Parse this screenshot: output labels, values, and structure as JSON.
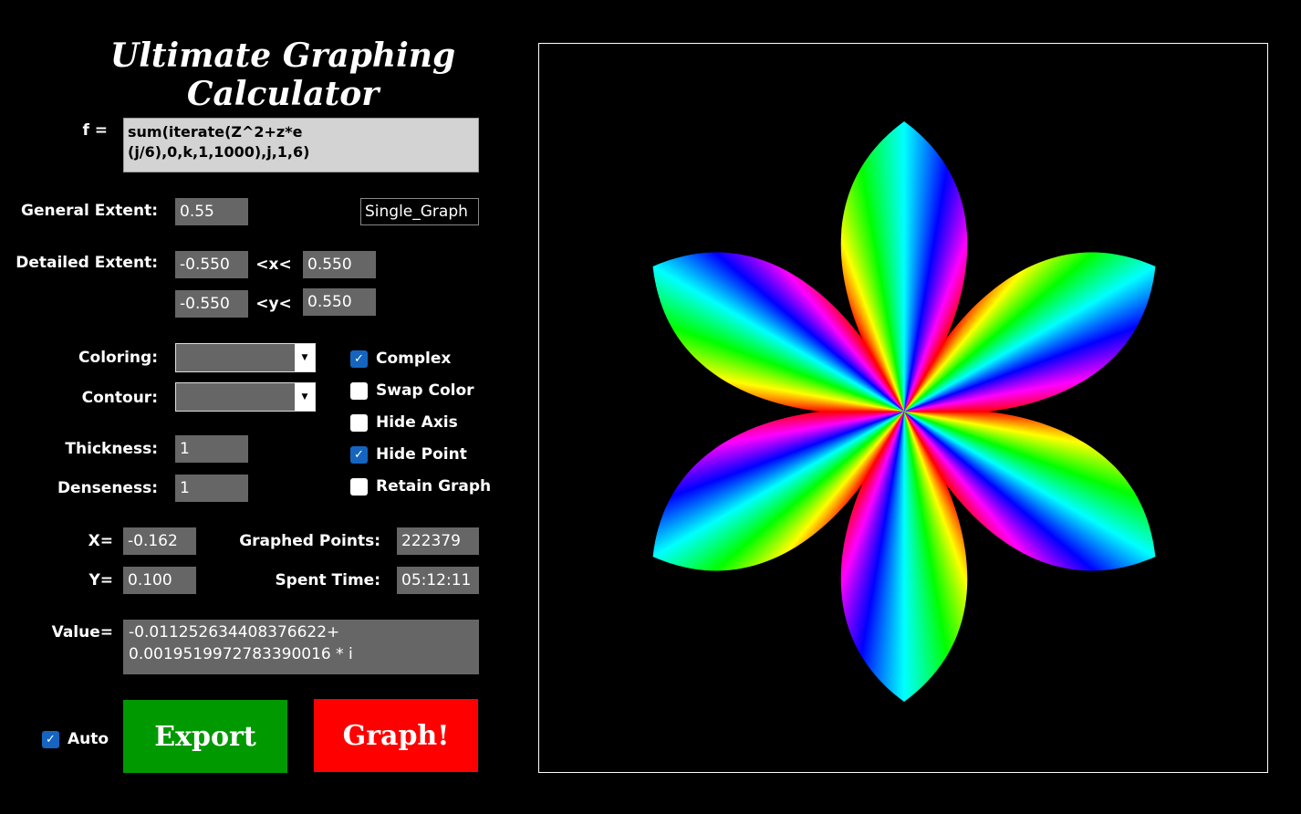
{
  "title": "Ultimate Graphing Calculator",
  "formula": {
    "label": "f =",
    "value": "sum(iterate(Z^2+z*e (j/6),0,k,1,1000),j,1,6)"
  },
  "general_extent": {
    "label": "General Extent:",
    "value": "0.55"
  },
  "mode": "Single_Graph",
  "detailed_extent": {
    "label": "Detailed Extent:",
    "x_min": "-0.550",
    "x_sep": "<x<",
    "x_max": "0.550",
    "y_min": "-0.550",
    "y_sep": "<y<",
    "y_max": "0.550"
  },
  "coloring": {
    "label": "Coloring:",
    "value": ""
  },
  "contour": {
    "label": "Contour:",
    "value": ""
  },
  "thickness": {
    "label": "Thickness:",
    "value": "1"
  },
  "denseness": {
    "label": "Denseness:",
    "value": "1"
  },
  "options": [
    {
      "label": "Complex",
      "checked": true
    },
    {
      "label": "Swap Color",
      "checked": false
    },
    {
      "label": "Hide Axis",
      "checked": false
    },
    {
      "label": "Hide Point",
      "checked": true
    },
    {
      "label": "Retain Graph",
      "checked": false
    }
  ],
  "x": {
    "label": "X=",
    "value": "-0.162"
  },
  "y": {
    "label": "Y=",
    "value": "0.100"
  },
  "graphed_points": {
    "label": "Graphed Points:",
    "value": "222379"
  },
  "spent_time": {
    "label": "Spent Time:",
    "value": "05:12:11"
  },
  "value": {
    "label": "Value=",
    "value": "-0.011252634408376622+ 0.0019519972783390016 * i"
  },
  "auto": {
    "label": "Auto",
    "checked": true
  },
  "buttons": {
    "export": "Export",
    "graph": "Graph!"
  },
  "colors": {
    "export": "#009900",
    "graph": "#ff0000",
    "checkbox": "#1565c0"
  }
}
